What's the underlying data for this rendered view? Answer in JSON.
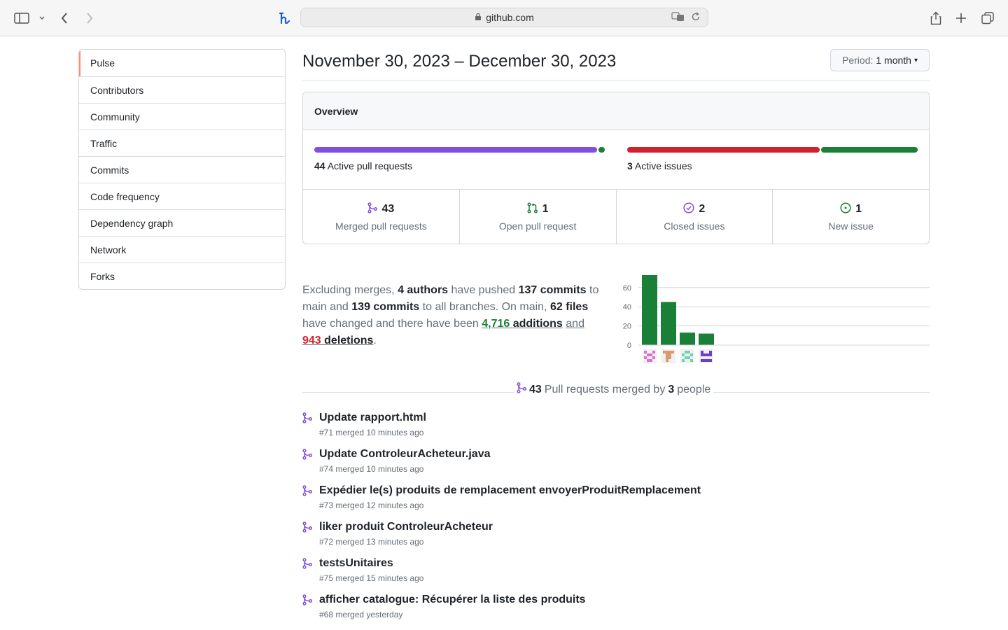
{
  "browser": {
    "url": "github.com"
  },
  "sidebar": {
    "items": [
      {
        "label": "Pulse",
        "selected": true
      },
      {
        "label": "Contributors"
      },
      {
        "label": "Community"
      },
      {
        "label": "Traffic"
      },
      {
        "label": "Commits"
      },
      {
        "label": "Code frequency"
      },
      {
        "label": "Dependency graph"
      },
      {
        "label": "Network"
      },
      {
        "label": "Forks"
      }
    ]
  },
  "header": {
    "date_range": "November 30, 2023 – December 30, 2023",
    "period_label": "Period:",
    "period_value": "1 month"
  },
  "overview": {
    "title": "Overview",
    "pull_requests": {
      "count": "44",
      "label": "Active pull requests",
      "merged_fraction": 0.977,
      "open_fraction": 0.023
    },
    "issues": {
      "count": "3",
      "label": "Active issues",
      "closed_fraction": 0.667,
      "new_fraction": 0.333
    },
    "stats": [
      {
        "count": "43",
        "label": "Merged pull requests",
        "icon": "merge-icon",
        "color": "#8250df"
      },
      {
        "count": "1",
        "label": "Open pull request",
        "icon": "pull-request-icon",
        "color": "#1a7f37"
      },
      {
        "count": "2",
        "label": "Closed issues",
        "icon": "issue-closed-icon",
        "color": "#8250df"
      },
      {
        "count": "1",
        "label": "New issue",
        "icon": "issue-opened-icon",
        "color": "#1a7f37"
      }
    ]
  },
  "summary": {
    "t1": "Excluding merges, ",
    "authors": "4 authors",
    "t2": " have pushed ",
    "commits_main": "137 commits",
    "t3": " to main and ",
    "commits_all": "139 commits",
    "t4": " to all branches. On main, ",
    "files": "62 files",
    "t5": " have changed and there have been ",
    "additions_num": "4,716",
    "additions_word": "additions",
    "t6": "and",
    "deletions_num": "943",
    "deletions_word": "deletions",
    "t7": "."
  },
  "chart_data": {
    "type": "bar",
    "categories": [
      "author-1",
      "author-2",
      "author-3",
      "author-4"
    ],
    "values": [
      73,
      45,
      13,
      12
    ],
    "ylim": [
      0,
      73
    ],
    "yticks": [
      "0",
      "20",
      "40",
      "60"
    ],
    "bar_color": "#1a7f37",
    "grid": true
  },
  "pr_section": {
    "count": "43",
    "mid_text": "Pull requests merged by",
    "people": "3",
    "people_word": "people"
  },
  "pull_requests": [
    {
      "title": "Update rapport.html",
      "meta": "#71 merged 10 minutes ago"
    },
    {
      "title": "Update ControleurAcheteur.java",
      "meta": "#74 merged 10 minutes ago"
    },
    {
      "title": "Expédier le(s) produits de remplacement envoyerProduitRemplacement",
      "meta": "#73 merged 12 minutes ago"
    },
    {
      "title": "liker produit ControleurAcheteur",
      "meta": "#72 merged 13 minutes ago"
    },
    {
      "title": "testsUnitaires",
      "meta": "#75 merged 15 minutes ago"
    },
    {
      "title": "afficher catalogue: Récupérer la liste des produits",
      "meta": "#68 merged yesterday"
    }
  ]
}
